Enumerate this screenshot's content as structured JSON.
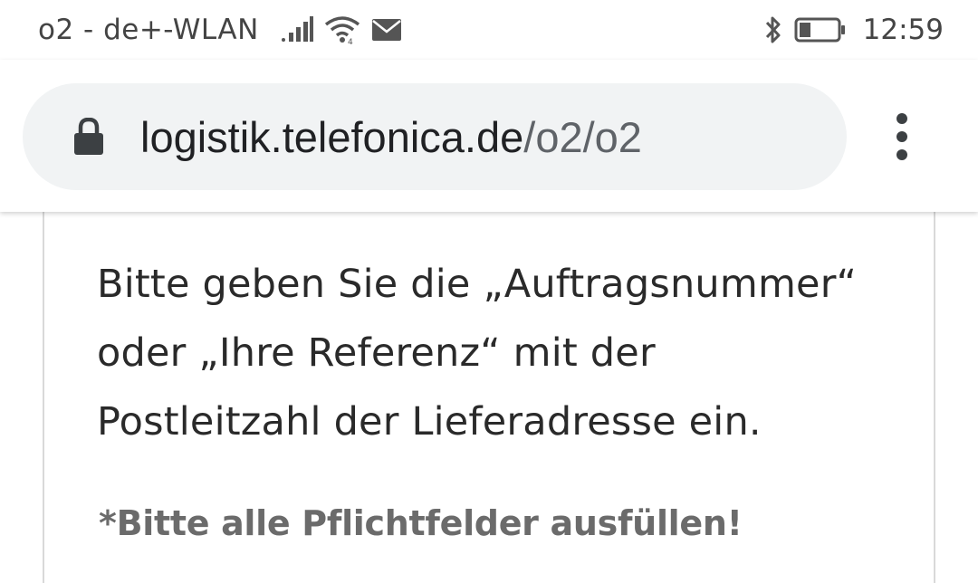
{
  "status_bar": {
    "carrier": "o2 - de+-WLAN",
    "time": "12:59",
    "icons": [
      "signal-icon",
      "wifi-icon",
      "mail-icon",
      "bluetooth-icon",
      "battery-icon"
    ]
  },
  "browser": {
    "url_domain": "logistik.telefonica.de",
    "url_path": "/o2/o2",
    "icons": [
      "lock-icon",
      "more-vert-icon"
    ]
  },
  "page": {
    "instructions_line1": "Bitte geben Sie die „Auftragsnummer“",
    "instructions_line2": "oder „Ihre Referenz“ mit der",
    "instructions_line3": "Postleitzahl der Lieferadresse ein.",
    "required_note": "*Bitte alle Pflichtfelder ausfüllen!"
  },
  "colors": {
    "url_bar_bg": "#f1f3f4",
    "text_primary": "#2a2a2a",
    "text_muted": "#6b6b6b"
  }
}
